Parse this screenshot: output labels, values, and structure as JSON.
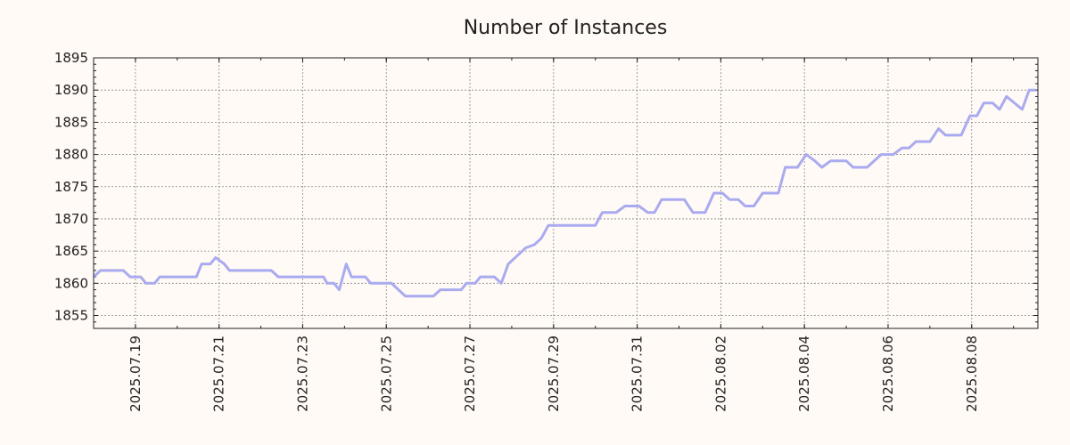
{
  "chart_data": {
    "type": "line",
    "title": "Number of Instances",
    "xlabel": "",
    "ylabel": "",
    "x_start": "2025-07-18",
    "x_end": "2025-08-09",
    "ylim": [
      1853,
      1895
    ],
    "y_ticks": [
      1855,
      1860,
      1865,
      1870,
      1875,
      1880,
      1885,
      1890,
      1895
    ],
    "x_tick_labels": [
      "2025.07.19",
      "2025.07.21",
      "2025.07.23",
      "2025.07.25",
      "2025.07.27",
      "2025.07.29",
      "2025.07.31",
      "2025.08.02",
      "2025.08.04",
      "2025.08.06",
      "2025.08.08"
    ],
    "grid": true,
    "series": [
      {
        "color": "#aaaaf0",
        "points": [
          [
            "2025-07-18T00:00",
            1861
          ],
          [
            "2025-07-18T04:00",
            1862
          ],
          [
            "2025-07-18T12:00",
            1862
          ],
          [
            "2025-07-18T17:00",
            1862
          ],
          [
            "2025-07-18T21:00",
            1861
          ],
          [
            "2025-07-19T03:00",
            1861
          ],
          [
            "2025-07-19T06:00",
            1860
          ],
          [
            "2025-07-19T11:00",
            1860
          ],
          [
            "2025-07-19T14:00",
            1861
          ],
          [
            "2025-07-19T20:00",
            1861
          ],
          [
            "2025-07-20T07:00",
            1861
          ],
          [
            "2025-07-20T11:00",
            1861
          ],
          [
            "2025-07-20T14:00",
            1863
          ],
          [
            "2025-07-20T19:00",
            1863
          ],
          [
            "2025-07-20T22:00",
            1864
          ],
          [
            "2025-07-21T03:00",
            1863
          ],
          [
            "2025-07-21T06:00",
            1862
          ],
          [
            "2025-07-21T12:00",
            1862
          ],
          [
            "2025-07-22T00:00",
            1862
          ],
          [
            "2025-07-22T06:00",
            1862
          ],
          [
            "2025-07-22T10:00",
            1861
          ],
          [
            "2025-07-22T20:00",
            1861
          ],
          [
            "2025-07-23T06:00",
            1861
          ],
          [
            "2025-07-23T12:00",
            1861
          ],
          [
            "2025-07-23T14:00",
            1860
          ],
          [
            "2025-07-23T18:00",
            1860
          ],
          [
            "2025-07-23T21:00",
            1859
          ],
          [
            "2025-07-24T01:00",
            1863
          ],
          [
            "2025-07-24T04:00",
            1861
          ],
          [
            "2025-07-24T12:00",
            1861
          ],
          [
            "2025-07-24T15:00",
            1860
          ],
          [
            "2025-07-24T20:00",
            1860
          ],
          [
            "2025-07-25T03:00",
            1860
          ],
          [
            "2025-07-25T07:00",
            1859
          ],
          [
            "2025-07-25T11:00",
            1858
          ],
          [
            "2025-07-25T16:00",
            1858
          ],
          [
            "2025-07-26T00:00",
            1858
          ],
          [
            "2025-07-26T03:00",
            1858
          ],
          [
            "2025-07-26T07:00",
            1859
          ],
          [
            "2025-07-26T12:00",
            1859
          ],
          [
            "2025-07-26T19:00",
            1859
          ],
          [
            "2025-07-26T22:00",
            1860
          ],
          [
            "2025-07-27T03:00",
            1860
          ],
          [
            "2025-07-27T06:00",
            1861
          ],
          [
            "2025-07-27T14:00",
            1861
          ],
          [
            "2025-07-27T18:00",
            1860
          ],
          [
            "2025-07-27T22:00",
            1863
          ],
          [
            "2025-07-28T04:00",
            1864.5
          ],
          [
            "2025-07-28T08:00",
            1865.5
          ],
          [
            "2025-07-28T13:00",
            1866
          ],
          [
            "2025-07-28T17:00",
            1867
          ],
          [
            "2025-07-28T21:00",
            1869
          ],
          [
            "2025-07-29T12:00",
            1869
          ],
          [
            "2025-07-30T00:00",
            1869
          ],
          [
            "2025-07-30T04:00",
            1871
          ],
          [
            "2025-07-30T12:00",
            1871
          ],
          [
            "2025-07-30T17:00",
            1872
          ],
          [
            "2025-07-31T01:00",
            1872
          ],
          [
            "2025-07-31T06:00",
            1871
          ],
          [
            "2025-07-31T10:00",
            1871
          ],
          [
            "2025-07-31T14:00",
            1873
          ],
          [
            "2025-07-31T20:00",
            1873
          ],
          [
            "2025-08-01T03:00",
            1873
          ],
          [
            "2025-08-01T08:00",
            1871
          ],
          [
            "2025-08-01T15:00",
            1871
          ],
          [
            "2025-08-01T20:00",
            1874
          ],
          [
            "2025-08-02T01:00",
            1874
          ],
          [
            "2025-08-02T05:00",
            1873
          ],
          [
            "2025-08-02T10:00",
            1873
          ],
          [
            "2025-08-02T14:00",
            1872
          ],
          [
            "2025-08-02T19:00",
            1872
          ],
          [
            "2025-08-03T00:00",
            1874
          ],
          [
            "2025-08-03T06:00",
            1874
          ],
          [
            "2025-08-03T09:00",
            1874
          ],
          [
            "2025-08-03T13:00",
            1878
          ],
          [
            "2025-08-03T20:00",
            1878
          ],
          [
            "2025-08-04T01:00",
            1880
          ],
          [
            "2025-08-04T06:00",
            1879
          ],
          [
            "2025-08-04T10:00",
            1878
          ],
          [
            "2025-08-04T15:00",
            1879
          ],
          [
            "2025-08-05T00:00",
            1879
          ],
          [
            "2025-08-05T04:00",
            1878
          ],
          [
            "2025-08-05T12:00",
            1878
          ],
          [
            "2025-08-05T20:00",
            1880
          ],
          [
            "2025-08-06T03:00",
            1880
          ],
          [
            "2025-08-06T08:00",
            1881
          ],
          [
            "2025-08-06T12:00",
            1881
          ],
          [
            "2025-08-06T16:00",
            1882
          ],
          [
            "2025-08-07T00:00",
            1882
          ],
          [
            "2025-08-07T05:00",
            1884
          ],
          [
            "2025-08-07T09:00",
            1883
          ],
          [
            "2025-08-07T18:00",
            1883
          ],
          [
            "2025-08-07T23:00",
            1886
          ],
          [
            "2025-08-08T03:00",
            1886
          ],
          [
            "2025-08-08T07:00",
            1888
          ],
          [
            "2025-08-08T12:00",
            1888
          ],
          [
            "2025-08-08T16:00",
            1887
          ],
          [
            "2025-08-08T20:00",
            1889
          ],
          [
            "2025-08-09T05:00",
            1887
          ],
          [
            "2025-08-09T09:00",
            1890
          ],
          [
            "2025-08-09T13:00",
            1890
          ]
        ]
      }
    ]
  }
}
